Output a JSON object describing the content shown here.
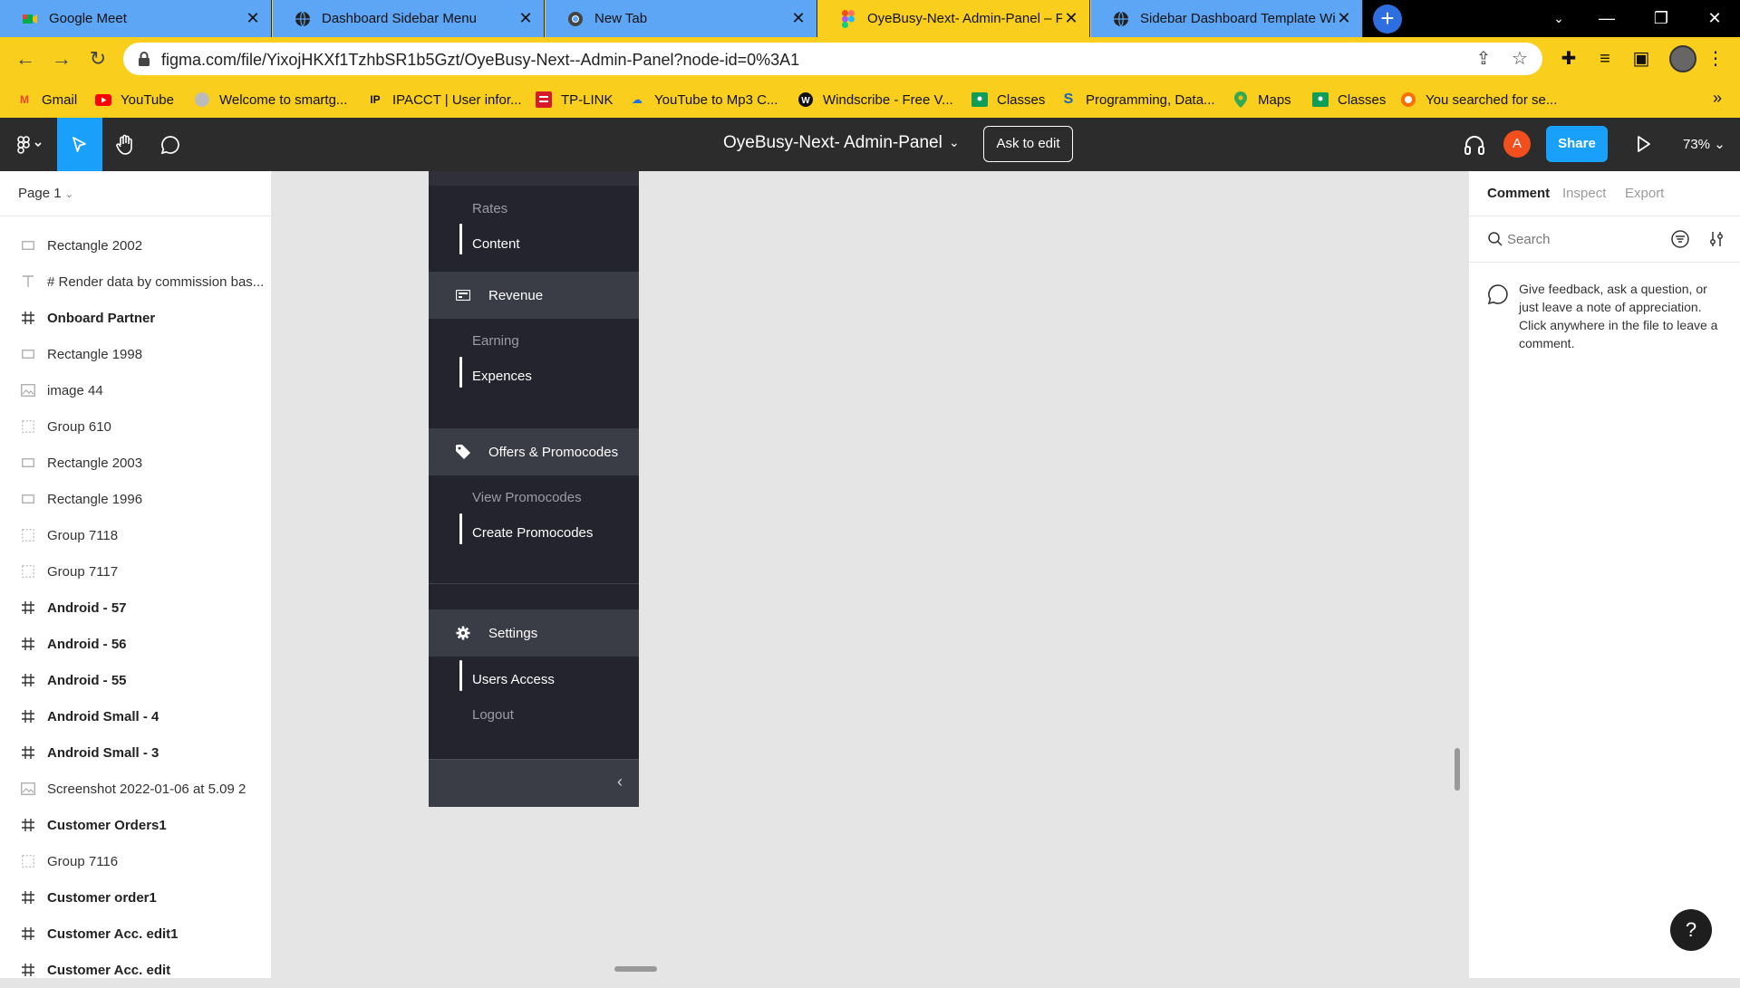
{
  "browser": {
    "tabs": [
      {
        "title": "Google Meet",
        "icon": "google-meet-icon"
      },
      {
        "title": "Dashboard Sidebar Menu",
        "icon": "globe-icon"
      },
      {
        "title": "New Tab",
        "icon": "chrome-icon"
      },
      {
        "title": "OyeBusy-Next- Admin-Panel – Fi",
        "icon": "figma-icon",
        "active": true
      },
      {
        "title": "Sidebar Dashboard Template Wit",
        "icon": "globe-icon"
      }
    ],
    "new_tab_label": "+",
    "url": "figma.com/file/YixojHKXf1TzhbSR1b5Gzt/OyeBusy-Next--Admin-Panel?node-id=0%3A1",
    "bookmarks": [
      {
        "label": "Gmail",
        "icon": "gmail-icon"
      },
      {
        "label": "YouTube",
        "icon": "youtube-icon"
      },
      {
        "label": "Welcome to smartg...",
        "icon": "globe-icon"
      },
      {
        "label": "IPACCT | User infor...",
        "icon": "ipacct-icon"
      },
      {
        "label": "TP-LINK",
        "icon": "tplink-icon"
      },
      {
        "label": "YouTube to Mp3 C...",
        "icon": "cloud-download-icon"
      },
      {
        "label": "Windscribe - Free V...",
        "icon": "windscribe-icon"
      },
      {
        "label": "Classes",
        "icon": "classroom-icon"
      },
      {
        "label": "Programming, Data...",
        "icon": "s-logo-icon"
      },
      {
        "label": "Maps",
        "icon": "maps-icon"
      },
      {
        "label": "Classes",
        "icon": "classroom-icon"
      },
      {
        "label": "You searched for se...",
        "icon": "site-icon"
      }
    ],
    "bookmarks_more": "»"
  },
  "figma": {
    "file_title": "OyeBusy-Next- Admin-Panel",
    "ask_to_edit": "Ask to edit",
    "avatar_letter": "A",
    "share_label": "Share",
    "zoom": "73%"
  },
  "layers": {
    "page_label": "Page 1",
    "items": [
      {
        "name": "Rectangle 2002",
        "type": "rect"
      },
      {
        "name": "# Render data by commission bas...",
        "type": "text"
      },
      {
        "name": "Onboard Partner",
        "type": "frame"
      },
      {
        "name": "Rectangle 1998",
        "type": "rect"
      },
      {
        "name": "image 44",
        "type": "image"
      },
      {
        "name": "Group 610",
        "type": "group"
      },
      {
        "name": "Rectangle 2003",
        "type": "rect"
      },
      {
        "name": "Rectangle 1996",
        "type": "rect"
      },
      {
        "name": "Group 7118",
        "type": "group"
      },
      {
        "name": "Group 7117",
        "type": "group"
      },
      {
        "name": "Android - 57",
        "type": "frame"
      },
      {
        "name": "Android - 56",
        "type": "frame"
      },
      {
        "name": "Android - 55",
        "type": "frame"
      },
      {
        "name": "Android Small - 4",
        "type": "frame"
      },
      {
        "name": "Android Small - 3",
        "type": "frame"
      },
      {
        "name": "Screenshot 2022-01-06 at 5.09 2",
        "type": "image"
      },
      {
        "name": "Customer Orders1",
        "type": "frame"
      },
      {
        "name": "Group 7116",
        "type": "group"
      },
      {
        "name": "Customer order1",
        "type": "frame"
      },
      {
        "name": "Customer Acc. edit1",
        "type": "frame"
      },
      {
        "name": "Customer Acc. edit",
        "type": "frame"
      }
    ]
  },
  "design_sidebar": {
    "rates": "Rates",
    "content": "Content",
    "revenue": "Revenue",
    "earning": "Earning",
    "expences": "Expences",
    "offers": "Offers & Promocodes",
    "view_promocodes": "View Promocodes",
    "create_promocodes": "Create Promocodes",
    "settings": "Settings",
    "users_access": "Users Access",
    "logout": "Logout",
    "collapse": "‹"
  },
  "right_panel": {
    "tabs": [
      "Comment",
      "Inspect",
      "Export"
    ],
    "search_placeholder": "Search",
    "hint": "Give feedback, ask a question, or just leave a note of appreciation. Click anywhere in the file to leave a comment."
  },
  "help_label": "?",
  "colors": {
    "browser_yellow": "#f9ce1d",
    "tab_blue": "#5ca6f5",
    "figma_dark": "#2c2c2c",
    "figma_blue": "#18a0fb",
    "sidebar_bg": "#23242d",
    "sidebar_section": "#3a3c46"
  }
}
